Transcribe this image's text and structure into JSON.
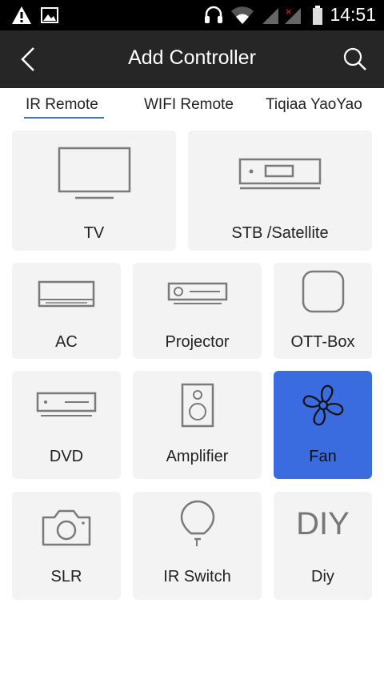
{
  "status_bar": {
    "time": "14:51"
  },
  "header": {
    "title": "Add Controller"
  },
  "tabs": [
    {
      "label": "IR Remote",
      "active": true
    },
    {
      "label": "WIFI Remote",
      "active": false
    },
    {
      "label": "Tiqiaa YaoYao",
      "active": false
    }
  ],
  "devices": {
    "tv": "TV",
    "stb": "STB /Satellite",
    "ac": "AC",
    "projector": "Projector",
    "ott": "OTT-Box",
    "dvd": "DVD",
    "amplifier": "Amplifier",
    "fan": "Fan",
    "slr": "SLR",
    "ir_switch": "IR Switch",
    "diy": "Diy",
    "diy_glyph": "DIY"
  },
  "selected_device": "Fan",
  "colors": {
    "accent": "#3a6cdf",
    "header_bg": "#262626",
    "tile_bg": "#f3f3f3",
    "icon": "#7a7a7a"
  },
  "icons": [
    "warning-icon",
    "image-icon",
    "headset-icon",
    "wifi-icon",
    "signal-icon",
    "battery-icon",
    "back-icon",
    "search-icon"
  ]
}
